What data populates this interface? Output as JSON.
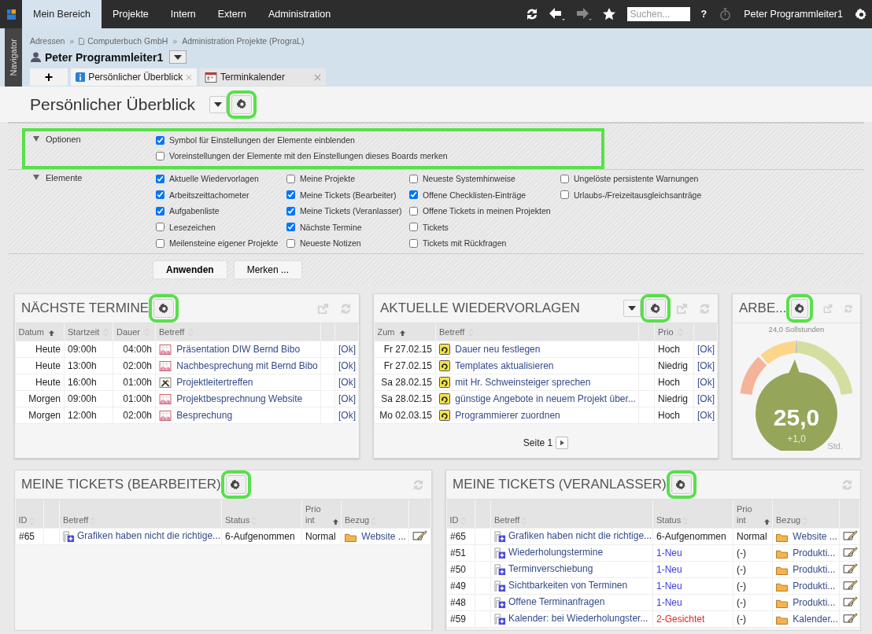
{
  "top_menu": [
    {
      "label": "Mein Bereich",
      "selected": true
    },
    {
      "label": "Projekte",
      "selected": false
    },
    {
      "label": "Intern",
      "selected": false
    },
    {
      "label": "Extern",
      "selected": false
    },
    {
      "label": "Administration",
      "selected": false
    }
  ],
  "toolbar": {
    "search": {
      "placeholder": "Suchen..."
    },
    "help": "?",
    "user": "Peter Programmleiter1"
  },
  "navigator_label": "Navigator",
  "breadcrumb": {
    "separator": "»",
    "items": [
      "Adressen",
      "Computerbuch GmbH",
      "Administration Projekte (PrograL)"
    ]
  },
  "person": "Peter Programmleiter1",
  "add_tab": "+",
  "tabs": [
    {
      "label": "Persönlicher Überblick",
      "selected": true
    },
    {
      "label": "Terminkalender",
      "selected": false
    }
  ],
  "page_title": "Persönlicher Überblick",
  "page_settings_highlighted": true,
  "options": {
    "label": "Optionen",
    "expanded": true,
    "highlighted": true,
    "items": [
      {
        "label": "Symbol für Einstellungen der Elemente einblenden",
        "checked": true
      },
      {
        "label": "Voreinstellungen der Elemente mit den Einstellungen dieses Boards merken",
        "checked": false
      }
    ]
  },
  "elements": {
    "label": "Elemente",
    "expanded": true,
    "columns": [
      [
        {
          "label": "Aktuelle Wiedervorlagen",
          "checked": true
        },
        {
          "label": "Arbeitszeittachometer",
          "checked": true
        },
        {
          "label": "Aufgabenliste",
          "checked": true
        },
        {
          "label": "Lesezeichen",
          "checked": false
        },
        {
          "label": "Meilensteine eigener Projekte",
          "checked": false
        }
      ],
      [
        {
          "label": "Meine Projekte",
          "checked": false
        },
        {
          "label": "Meine Tickets (Bearbeiter)",
          "checked": true
        },
        {
          "label": "Meine Tickets (Veranlasser)",
          "checked": true
        },
        {
          "label": "Nächste Termine",
          "checked": true
        },
        {
          "label": "Neueste Notizen",
          "checked": false
        }
      ],
      [
        {
          "label": "Neueste Systemhinweise",
          "checked": false
        },
        {
          "label": "Offene Checklisten-Einträge",
          "checked": true
        },
        {
          "label": "Offene Tickets in meinen Projekten",
          "checked": false
        },
        {
          "label": "Tickets",
          "checked": false
        },
        {
          "label": "Tickets mit Rückfragen",
          "checked": false
        }
      ],
      [
        {
          "label": "Ungelöste persistente Warnungen",
          "checked": false
        },
        {
          "label": "Urlaubs-/Freizeitausgleichsanträge",
          "checked": false
        }
      ]
    ]
  },
  "buttons": [
    {
      "label": "Anwenden",
      "primary": true
    },
    {
      "label": "Merken ...",
      "primary": false
    }
  ],
  "termine": {
    "title": "NÄCHSTE TERMINE",
    "settings_highlighted": true,
    "columns": [
      {
        "label": "Datum",
        "sorted": true
      },
      {
        "label": "Startzeit",
        "sorted": false
      },
      {
        "label": "Dauer",
        "sorted": false
      },
      {
        "label": "Betreff",
        "sorted": false
      }
    ],
    "rows": [
      {
        "kind": "appointment",
        "datum": "Heute",
        "start": "09:00h",
        "dauer": "04:00h",
        "betreff": "Präsentation DIW Bernd Bibo",
        "ok": "[Ok]"
      },
      {
        "kind": "appointment",
        "datum": "Heute",
        "start": "13:00h",
        "dauer": "02:00h",
        "betreff": "Nachbesprechung mit Bernd Bibo",
        "ok": "[Ok]"
      },
      {
        "kind": "meeting",
        "datum": "Heute",
        "start": "16:00h",
        "dauer": "01:00h",
        "betreff": "Projektleitertreffen",
        "ok": "[Ok]"
      },
      {
        "kind": "appointment",
        "datum": "Morgen",
        "start": "09:00h",
        "dauer": "01:00h",
        "betreff": "Projektbesprechnung Website",
        "ok": "[Ok]"
      },
      {
        "kind": "appointment",
        "datum": "Morgen",
        "start": "12:00h",
        "dauer": "02:00h",
        "betreff": "Besprechung",
        "ok": "[Ok]"
      }
    ]
  },
  "wiedervorlagen": {
    "title": "AKTUELLE WIEDERVORLAGEN",
    "settings_highlighted": true,
    "columns": [
      {
        "label": "Zum",
        "sorted": true
      },
      {
        "label": "Betreff",
        "sorted": false
      },
      {
        "label": "Prio",
        "sorted": false
      }
    ],
    "rows": [
      {
        "zum": "Fr 27.02.15",
        "betreff": "Dauer neu festlegen",
        "prio": "Hoch",
        "ok": "[Ok]"
      },
      {
        "zum": "Fr 27.02.15",
        "betreff": "Templates aktualisieren",
        "prio": "Niedrig",
        "ok": "[Ok]"
      },
      {
        "zum": "Sa 28.02.15",
        "betreff": "mit Hr. Schweinsteiger sprechen",
        "prio": "Hoch",
        "ok": "[Ok]"
      },
      {
        "zum": "Sa 28.02.15",
        "betreff": "günstige Angebote in neuem Projekt über...",
        "prio": "Niedrig",
        "ok": "[Ok]"
      },
      {
        "zum": "Mo 02.03.15",
        "betreff": "Programmierer zuordnen",
        "prio": "Hoch",
        "ok": "[Ok]"
      }
    ],
    "pager": "Seite 1"
  },
  "arbeitszeit": {
    "title": "ARBE...",
    "settings_highlighted": true,
    "target": "24,0 Sollstunden",
    "value": "25,0",
    "delta": "+1,0",
    "unit": "Std."
  },
  "tickets": [
    {
      "title": "MEINE TICKETS (BEARBEITER)",
      "settings_highlighted": true,
      "columns": [
        {
          "label": "ID",
          "sorted": false
        },
        {
          "label": "Betreff",
          "sorted": false
        },
        {
          "label": "Status",
          "sorted": false
        },
        {
          "label": "Prio int",
          "sorted": true
        },
        {
          "label": "Bezug",
          "sorted": false
        }
      ],
      "rows": [
        {
          "id": "#65",
          "betreff": "Grafiken haben nicht die richtige...",
          "status": "6-Aufgenommen",
          "color": "#222222",
          "prio": "Normal",
          "bezug": "Website ..."
        }
      ]
    },
    {
      "title": "MEINE TICKETS (VERANLASSER)",
      "settings_highlighted": true,
      "columns": [
        {
          "label": "ID",
          "sorted": false
        },
        {
          "label": "Betreff",
          "sorted": false
        },
        {
          "label": "Status",
          "sorted": false
        },
        {
          "label": "Prio int",
          "sorted": true
        },
        {
          "label": "Bezug",
          "sorted": false
        }
      ],
      "rows": [
        {
          "id": "#65",
          "betreff": "Grafiken haben nicht die richtige...",
          "status": "6-Aufgenommen",
          "color": "#222222",
          "prio": "Normal",
          "bezug": "Website ..."
        },
        {
          "id": "#51",
          "betreff": "Wiederholungstermine",
          "status": "1-Neu",
          "color": "#3a3ae0",
          "prio": "(-)",
          "bezug": "Produkti..."
        },
        {
          "id": "#50",
          "betreff": "Terminverschiebung",
          "status": "1-Neu",
          "color": "#3a3ae0",
          "prio": "(-)",
          "bezug": "Produkti..."
        },
        {
          "id": "#49",
          "betreff": "Sichtbarkeiten von Terminen",
          "status": "1-Neu",
          "color": "#3a3ae0",
          "prio": "(-)",
          "bezug": "Produkti..."
        },
        {
          "id": "#48",
          "betreff": "Offene Terminanfragen",
          "status": "1-Neu",
          "color": "#3a3ae0",
          "prio": "(-)",
          "bezug": "Produkti..."
        },
        {
          "id": "#59",
          "betreff": "Kalender: bei Wiederholungster...",
          "status": "2-Gesichtet",
          "color": "#ee2222",
          "prio": "(-)",
          "bezug": "Kalender..."
        }
      ]
    }
  ]
}
